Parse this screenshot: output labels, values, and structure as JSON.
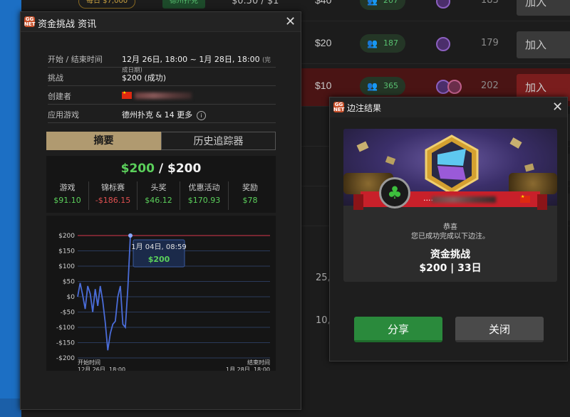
{
  "background": {
    "top_strip": {
      "tag1": "每日 $7,000",
      "tag2": "德州扑克",
      "stakes": "$0.50 / $1"
    },
    "rows": [
      {
        "buyin": "$40",
        "players": "207",
        "count": "183",
        "join": "加入"
      },
      {
        "buyin": "$20",
        "players": "187",
        "count": "179",
        "join": "加入"
      },
      {
        "buyin": "$10",
        "players": "365",
        "count": "202",
        "join": "加入"
      }
    ],
    "side_numbers": [
      "25,",
      "10,"
    ]
  },
  "info_dialog": {
    "title": "资金挑战 资讯",
    "rows": [
      {
        "key": "开始 / 结束时间",
        "value": "12月 26日, 18:00 ~ 1月 28日, 18:00",
        "note": "(完成日期)"
      },
      {
        "key": "挑战",
        "value": "$200 (成功)"
      },
      {
        "key": "创建者",
        "value": ""
      },
      {
        "key": "应用游戏",
        "value": "德州扑克 & 14 更多"
      }
    ],
    "tabs": {
      "summary": "摘要",
      "history": "历史追踪器"
    },
    "summary": {
      "current": "$200",
      "separator": " / ",
      "target": "$200",
      "stats": [
        {
          "label": "游戏",
          "value": "$91.10",
          "color": "#5bd05b"
        },
        {
          "label": "锦标赛",
          "value": "-$186.15",
          "color": "#e05050"
        },
        {
          "label": "头奖",
          "value": "$46.12",
          "color": "#5bd05b"
        },
        {
          "label": "优惠活动",
          "value": "$170.93",
          "color": "#5bd05b"
        },
        {
          "label": "奖励",
          "value": "$78",
          "color": "#5bd05b"
        }
      ]
    }
  },
  "chart_data": {
    "type": "line",
    "ylim": [
      -200,
      200
    ],
    "y_ticks": [
      "$200",
      "$150",
      "$100",
      "$50",
      "$0",
      "-$50",
      "-$100",
      "-$150",
      "-$200"
    ],
    "x_labels": [
      {
        "line1": "开始时间",
        "line2": "12月 26日, 18:00"
      },
      {
        "line1": "结束时间",
        "line2": "1月 28日, 18:00"
      }
    ],
    "target_line": 200,
    "values": [
      0,
      45,
      5,
      -40,
      35,
      10,
      -50,
      25,
      -30,
      35,
      -15,
      -85,
      -175,
      -120,
      -90,
      -80,
      0,
      35,
      -90,
      -100,
      30,
      200
    ],
    "tooltip": {
      "date": "1月 04日, 08:59",
      "value": "$200"
    },
    "line_color": "#4a6cd8",
    "target_color": "#b03040"
  },
  "result_dialog": {
    "title": "边注结果",
    "player_name": "....",
    "congrats": "恭喜",
    "congrats_sub": "您已成功完成以下边注。",
    "challenge_name": "资金挑战",
    "challenge_detail": "$200 | 33日",
    "share_button": "分享",
    "close_button": "关闭"
  }
}
